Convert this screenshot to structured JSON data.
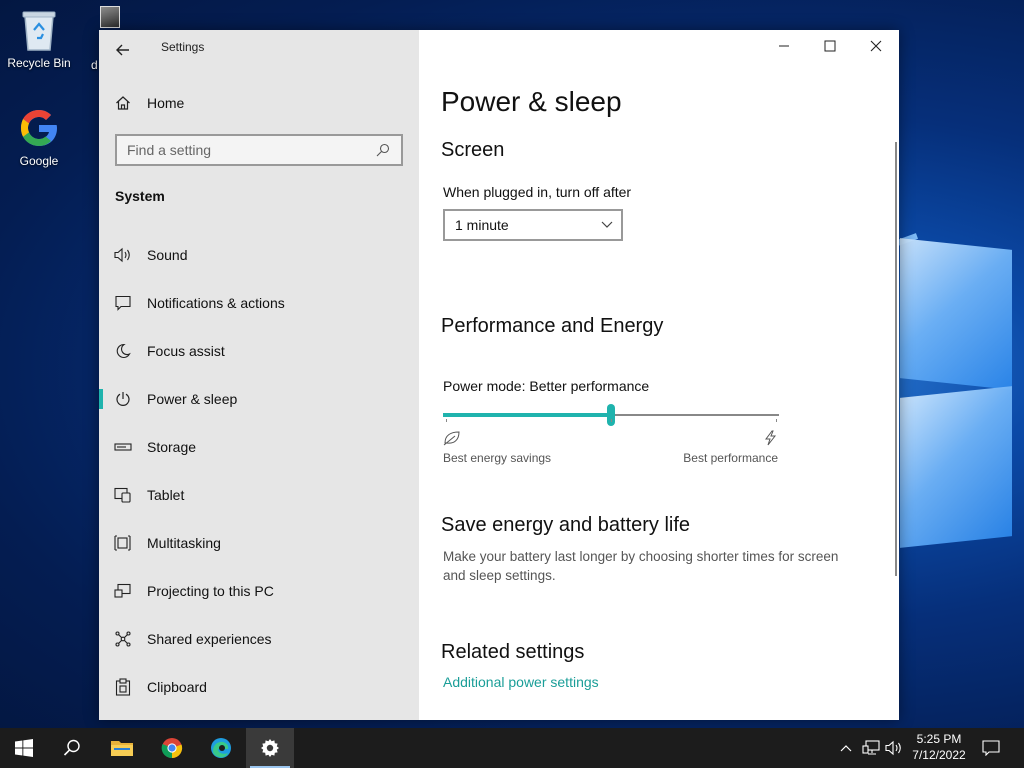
{
  "desktop": {
    "icons": [
      {
        "label": "Recycle Bin",
        "icon": "recycle-bin-icon"
      },
      {
        "label": "Google",
        "icon": "google-chrome-icon"
      }
    ],
    "partial_label": "d"
  },
  "window": {
    "title": "Settings",
    "controls": {
      "minimize": "minimize-icon",
      "maximize": "maximize-icon",
      "close": "close-icon"
    }
  },
  "sidebar": {
    "home_label": "Home",
    "search": {
      "placeholder": "Find a setting",
      "value": ""
    },
    "section_label": "System",
    "items": [
      {
        "label": "Sound",
        "icon": "sound-icon",
        "selected": false
      },
      {
        "label": "Notifications & actions",
        "icon": "notifications-icon",
        "selected": false
      },
      {
        "label": "Focus assist",
        "icon": "moon-icon",
        "selected": false
      },
      {
        "label": "Power & sleep",
        "icon": "power-icon",
        "selected": true
      },
      {
        "label": "Storage",
        "icon": "storage-icon",
        "selected": false
      },
      {
        "label": "Tablet",
        "icon": "tablet-icon",
        "selected": false
      },
      {
        "label": "Multitasking",
        "icon": "multitasking-icon",
        "selected": false
      },
      {
        "label": "Projecting to this PC",
        "icon": "projecting-icon",
        "selected": false
      },
      {
        "label": "Shared experiences",
        "icon": "shared-experiences-icon",
        "selected": false
      },
      {
        "label": "Clipboard",
        "icon": "clipboard-icon",
        "selected": false
      }
    ]
  },
  "content": {
    "page_title": "Power & sleep",
    "screen": {
      "heading": "Screen",
      "plugged_label": "When plugged in, turn off after",
      "plugged_value": "1 minute"
    },
    "performance": {
      "heading": "Performance and Energy",
      "mode_label": "Power mode: Better performance",
      "slider_fraction": 0.5,
      "left_label": "Best energy savings",
      "right_label": "Best performance"
    },
    "save_energy": {
      "heading": "Save energy and battery life",
      "description": "Make your battery last longer by choosing shorter times for screen and sleep settings."
    },
    "related": {
      "heading": "Related settings",
      "link": "Additional power settings"
    }
  },
  "taskbar": {
    "clock_time": "5:25 PM",
    "clock_date": "7/12/2022",
    "active_app": "settings"
  },
  "colors": {
    "accent": "#1fb3ad",
    "link": "#1a9e98",
    "sidebar_bg": "#e6e6e6",
    "taskbar_bg": "#1c1c1c"
  }
}
